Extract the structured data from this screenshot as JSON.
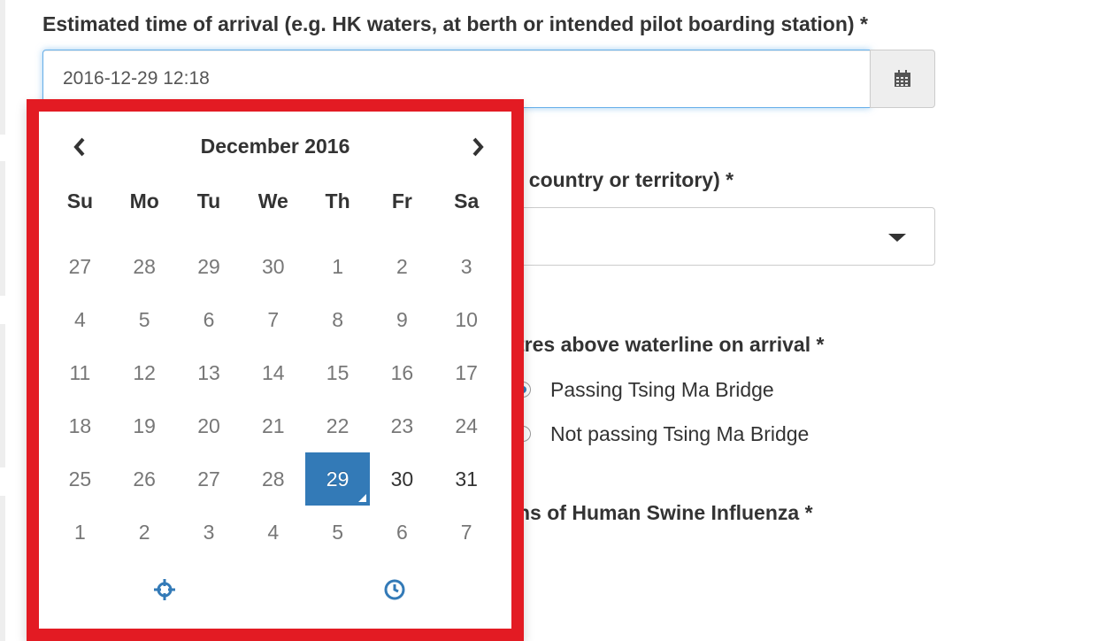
{
  "form": {
    "eta_label": "Estimated time of arrival (e.g. HK waters, at berth or intended pilot boarding station) *",
    "eta_value": "2016-12-29 12:18",
    "country_label_fragment": "l country or territory) *",
    "height_label_fragment": "tres above waterline on arrival *",
    "bridge_options": [
      {
        "label": "Passing Tsing Ma Bridge",
        "checked": true
      },
      {
        "label": "Not passing Tsing Ma Bridge",
        "checked": false
      }
    ],
    "influenza_label_fragment": "ns of Human Swine Influenza *"
  },
  "datepicker": {
    "month_title": "December 2016",
    "weekdays": [
      "Su",
      "Mo",
      "Tu",
      "We",
      "Th",
      "Fr",
      "Sa"
    ],
    "weeks": [
      [
        "27",
        "28",
        "29",
        "30",
        "1",
        "2",
        "3"
      ],
      [
        "4",
        "5",
        "6",
        "7",
        "8",
        "9",
        "10"
      ],
      [
        "11",
        "12",
        "13",
        "14",
        "15",
        "16",
        "17"
      ],
      [
        "18",
        "19",
        "20",
        "21",
        "22",
        "23",
        "24"
      ],
      [
        "25",
        "26",
        "27",
        "28",
        "29",
        "30",
        "31"
      ],
      [
        "1",
        "2",
        "3",
        "4",
        "5",
        "6",
        "7"
      ]
    ],
    "selected_day": "29",
    "icons": {
      "prev": "chevron-left-icon",
      "next": "chevron-right-icon",
      "today": "crosshairs-icon",
      "time": "clock-icon",
      "calendar": "calendar-icon"
    }
  },
  "colors": {
    "highlight_border": "#e31b23",
    "selected_day_bg": "#337ab7",
    "icon_blue": "#337ab7"
  }
}
